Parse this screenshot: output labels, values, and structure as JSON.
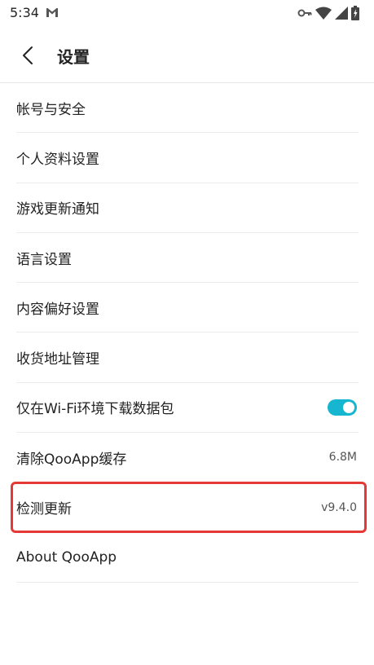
{
  "status_bar": {
    "time": "5:34",
    "icons": [
      "gmail-icon",
      "key-icon",
      "wifi-icon",
      "signal-icon",
      "battery-icon"
    ]
  },
  "header": {
    "title": "设置",
    "back_icon": "back-arrow-icon"
  },
  "settings": {
    "items": [
      {
        "label": "帐号与安全"
      },
      {
        "label": "个人资料设置"
      },
      {
        "label": "游戏更新通知"
      },
      {
        "label": "语言设置"
      },
      {
        "label": "内容偏好设置"
      },
      {
        "label": "收货地址管理"
      },
      {
        "label": "仅在Wi-Fi环境下载数据包",
        "toggle": true
      },
      {
        "label": "清除QooApp缓存",
        "value": "6.8M"
      },
      {
        "label": "检测更新",
        "value": "v9.4.0",
        "highlighted": true
      },
      {
        "label": "About QooApp"
      }
    ]
  },
  "colors": {
    "accent": "#16b5d0",
    "highlight": "#e53935"
  }
}
